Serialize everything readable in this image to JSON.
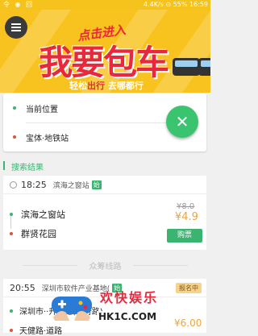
{
  "status_bar": {
    "left": "令 ◉ 回",
    "right": "4.4K/s  ⊙  55%  16:59"
  },
  "banner": {
    "small": "点击进入",
    "headline": "我要包车",
    "tagline_pre": "轻松",
    "tagline_hi": "出行",
    "tagline_post": " 去哪都行"
  },
  "location": {
    "current_label": "当前位置",
    "destination_label": "宝体·地铁站"
  },
  "fab_icon": "close-icon",
  "search_results": {
    "header": "搜索结果",
    "card": {
      "time": "18:25",
      "start_station": "滨海之窗站",
      "start_tag": "始",
      "stop_from": "滨海之窗站",
      "stop_to": "群贤花园",
      "old_price": "¥8.0",
      "new_price": "¥4.9",
      "buy_label": "购票"
    }
  },
  "crowd_section": {
    "title": "众筹线路",
    "card": {
      "time": "20:55",
      "start_station": "深圳市软件产业基地(",
      "start_tag": "始",
      "badge": "报名中",
      "stop_from": "深圳市··升···地(学府路)",
      "stop_to": "天健路·道路",
      "price": "¥6.00"
    }
  },
  "watermark": {
    "title": "欢快娱乐",
    "sub": "HK1C.COM"
  },
  "colors": {
    "accent": "#3bb371",
    "banner": "#f8c31e",
    "price": "#f0a43a",
    "headline": "#e8283c"
  }
}
